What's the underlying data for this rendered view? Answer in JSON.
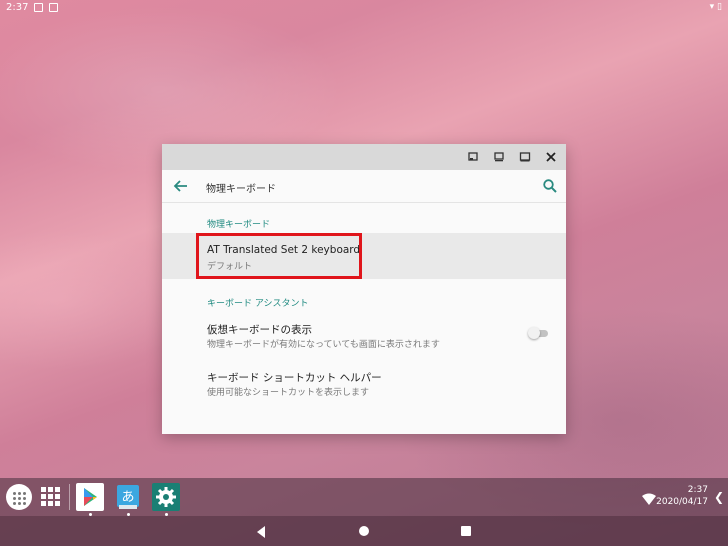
{
  "status_bar": {
    "time": "2:37"
  },
  "window": {
    "title": "物理キーボード",
    "controls": [
      "minimize",
      "restore",
      "maximize",
      "close"
    ],
    "sections": [
      {
        "header": "物理キーボード",
        "items": [
          {
            "title": "AT Translated Set 2 keyboard",
            "summary": "デフォルト",
            "highlighted": true
          }
        ]
      },
      {
        "header": "キーボード アシスタント",
        "items": [
          {
            "title": "仮想キーボードの表示",
            "summary": "物理キーボードが有効になっていても画面に表示されます",
            "toggle": false
          },
          {
            "title": "キーボード ショートカット ヘルパー",
            "summary": "使用可能なショートカットを表示します"
          }
        ]
      }
    ]
  },
  "taskbar": {
    "apps": [
      "Play Store",
      "Japanese Input",
      "Settings"
    ],
    "clock_time": "2:37",
    "clock_date": "2020/04/17"
  },
  "colors": {
    "accent": "#1f8a80",
    "highlight_border": "#e0151b",
    "settings_icon_bg": "#1a7f74"
  }
}
